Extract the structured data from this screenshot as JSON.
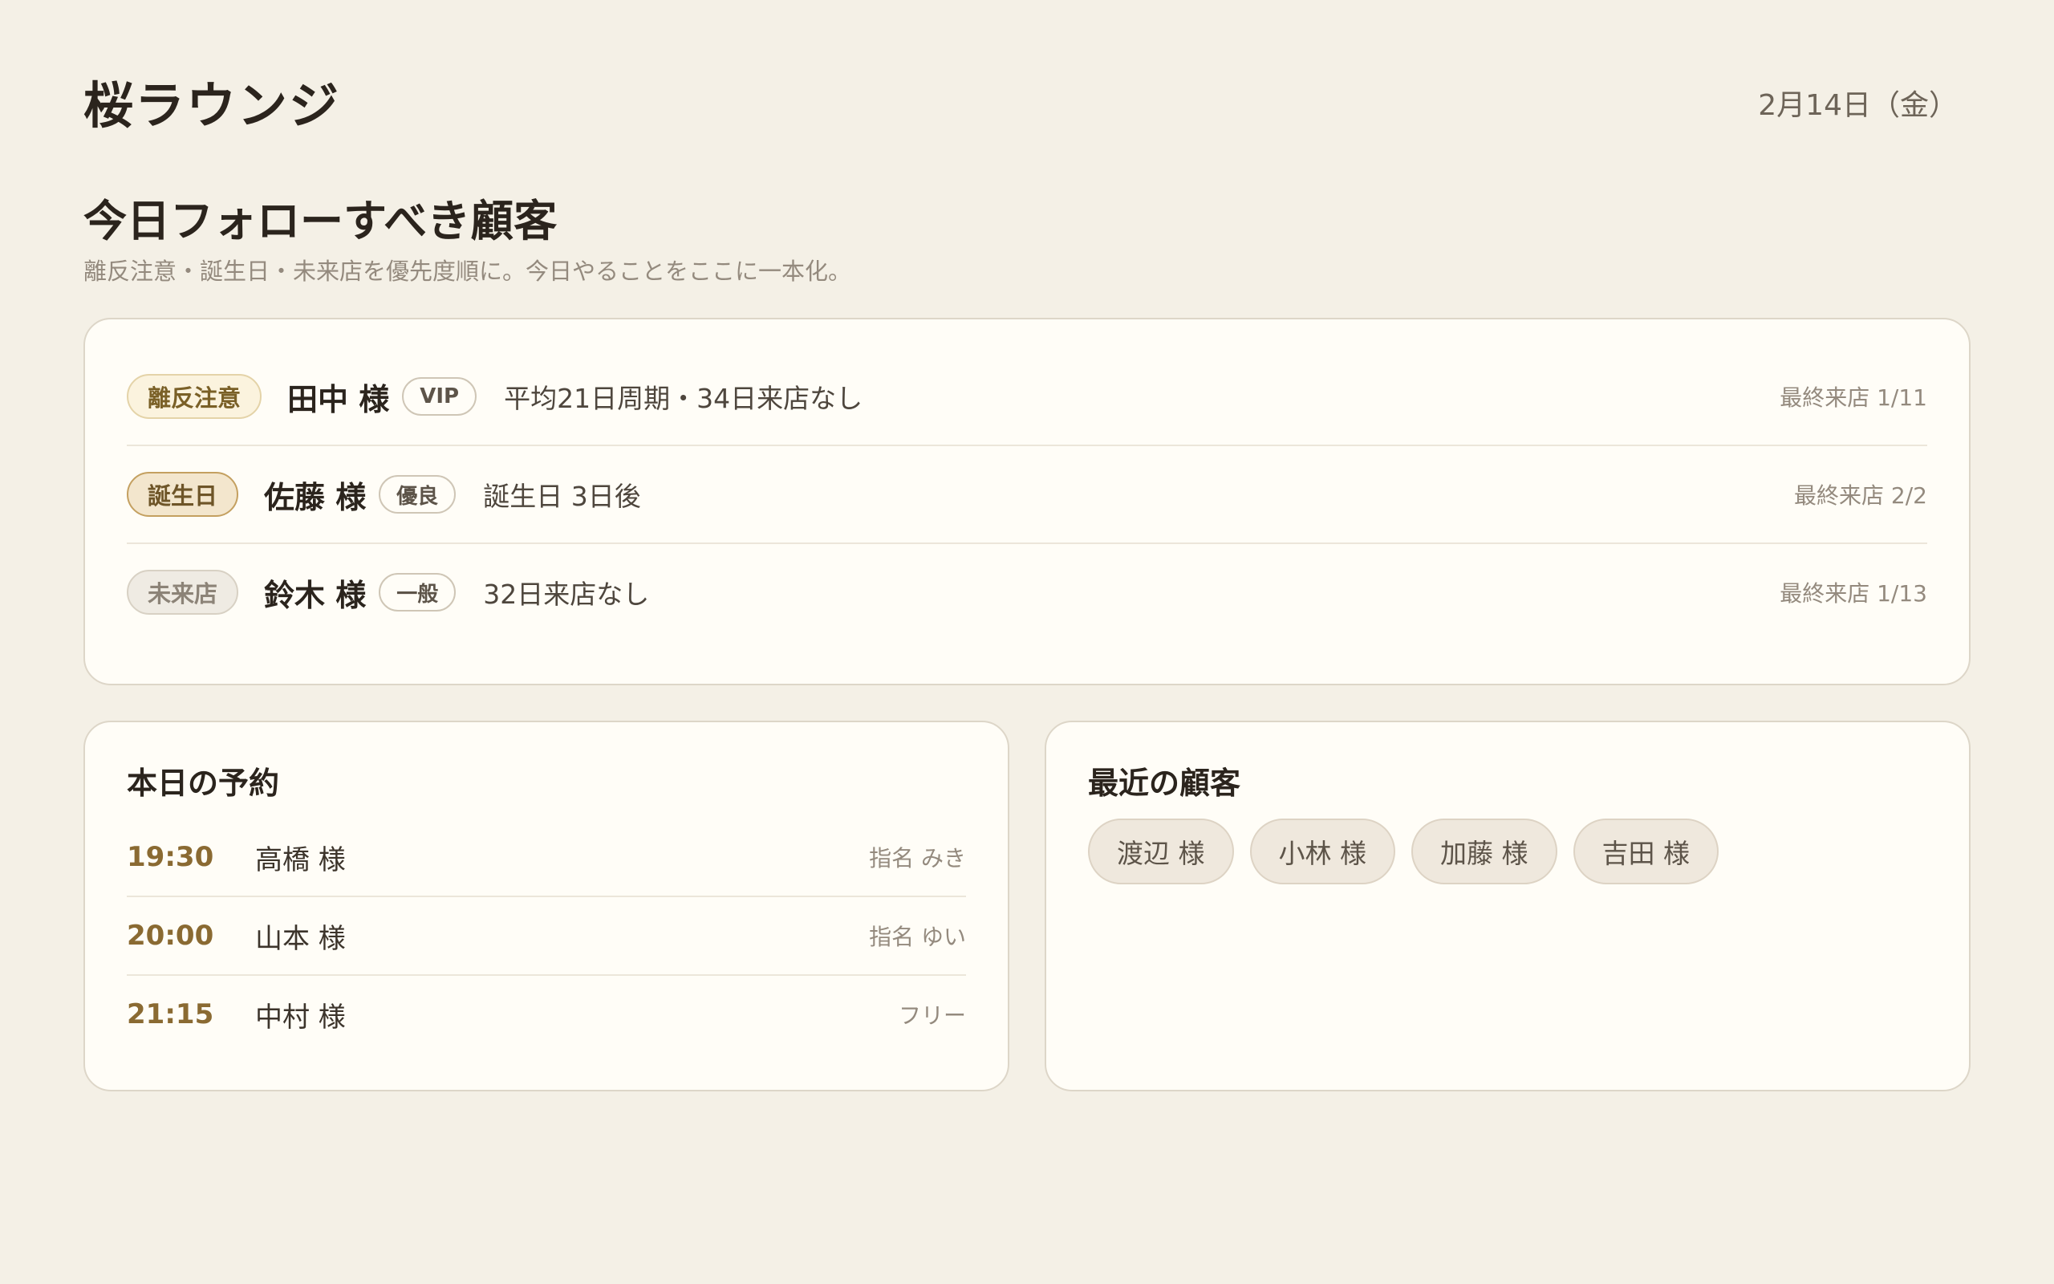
{
  "header": {
    "brand": "桜ラウンジ",
    "date": "2月14日（金）"
  },
  "follow": {
    "title": "今日フォローすべき顧客",
    "subtitle": "離反注意・誕生日・未来店を優先度順に。今日やることをここに一本化。",
    "items": [
      {
        "tag": "離反注意",
        "name": "田中 様",
        "rank": "VIP",
        "note": "平均21日周期・34日来店なし",
        "last_visit": "最終来店 1/11"
      },
      {
        "tag": "誕生日",
        "name": "佐藤 様",
        "rank": "優良",
        "note": "誕生日 3日後",
        "last_visit": "最終来店 2/2"
      },
      {
        "tag": "未来店",
        "name": "鈴木 様",
        "rank": "一般",
        "note": "32日来店なし",
        "last_visit": "最終来店 1/13"
      }
    ]
  },
  "reservations": {
    "title": "本日の予約",
    "items": [
      {
        "time": "19:30",
        "name": "高橋 様",
        "note": "指名 みき"
      },
      {
        "time": "20:00",
        "name": "山本 様",
        "note": "指名 ゆい"
      },
      {
        "time": "21:15",
        "name": "中村 様",
        "note": "フリー"
      }
    ]
  },
  "recent": {
    "title": "最近の顧客",
    "chips": [
      "渡辺 様",
      "小林 様",
      "加藤 様",
      "吉田 様"
    ]
  }
}
